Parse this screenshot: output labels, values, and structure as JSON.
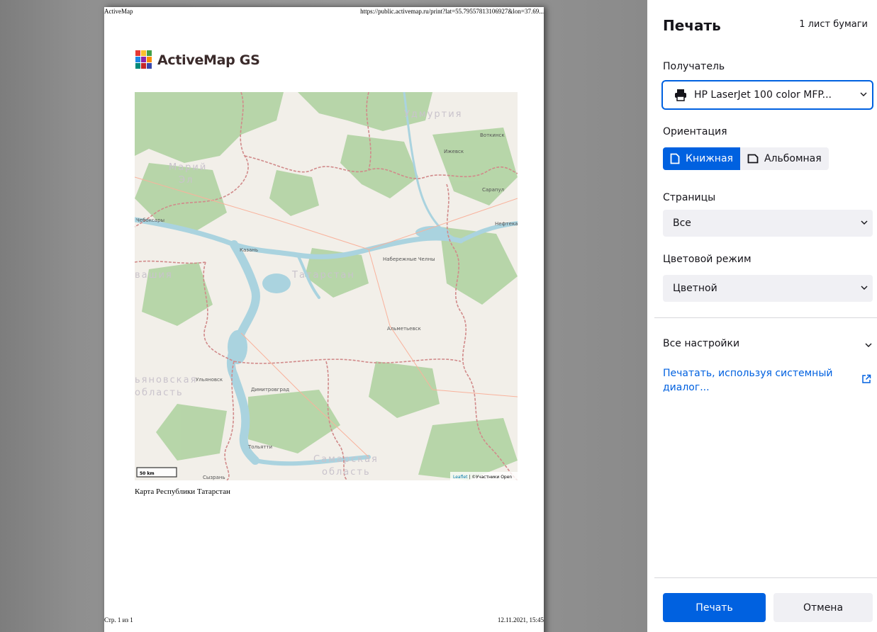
{
  "preview": {
    "header_left": "ActiveMap",
    "header_right": "https://public.activemap.ru/print?lat=55.79557813106927&lon=37.69...",
    "footer_left": "Стр. 1 из 1",
    "footer_right": "12.11.2021, 15:45",
    "logo_text": "ActiveMap GS",
    "map_caption": "Карта Республики Татарстан",
    "map_labels": {
      "udmurtia": "Удмуртия",
      "votkinsk": "Воткинск",
      "izhevsk": "Ижевск",
      "mariy_el_1": "Марий",
      "mariy_el_2": "Эл",
      "sarapul": "Сарапул",
      "cheboksary": "Чебоксары",
      "neftekamsk": "Нефтекам",
      "kazan": "Казань",
      "naberezhnye_chelny": "Набережные Челны",
      "tatarstan": "Татарстан",
      "chuvashia": "вашия",
      "almetyevsk": "Альметьевск",
      "ulyanovsk_region_1": "ьяновская",
      "ulyanovsk_region_2": "область",
      "ulyanovsk": "Ульяновск",
      "dimitrovgrad": "Димитровград",
      "tolyatti": "Тольятти",
      "samara_region_1": "Самарская",
      "samara_region_2": "область",
      "syzran": "Сызрань",
      "scale": "50 km",
      "attribution_link": "Leaflet",
      "attribution_text": " | ©Участники Open"
    }
  },
  "panel": {
    "title": "Печать",
    "sheet_count": "1 лист бумаги",
    "recipient_label": "Получатель",
    "printer_name": "HP LaserJet 100 color MFP...",
    "orientation_label": "Ориентация",
    "orientation_portrait": "Книжная",
    "orientation_landscape": "Альбомная",
    "orientation_selected": "Книжная",
    "pages_label": "Страницы",
    "pages_value": "Все",
    "color_mode_label": "Цветовой режим",
    "color_mode_value": "Цветной",
    "more_settings": "Все настройки",
    "system_dialog_link": "Печатать, используя системный диалог...",
    "print_button": "Печать",
    "cancel_button": "Отмена"
  },
  "colors": {
    "accent": "#0061e0",
    "map_water": "#aad3df",
    "map_forest": "#add19e",
    "map_land": "#f2efe9",
    "map_border": "#d18a8a"
  }
}
